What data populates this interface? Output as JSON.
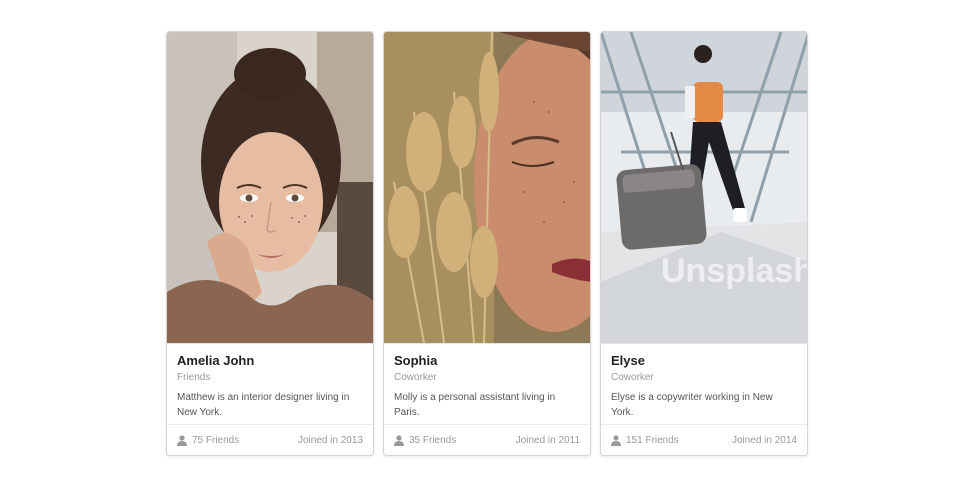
{
  "cards": [
    {
      "name": "Amelia John",
      "meta": "Friends",
      "description": "Matthew is an interior designer living in New York.",
      "friends": "75 Friends",
      "joined": "Joined in 2013"
    },
    {
      "name": "Sophia",
      "meta": "Coworker",
      "description": "Molly is a personal assistant living in Paris.",
      "friends": "35 Friends",
      "joined": "Joined in 2011"
    },
    {
      "name": "Elyse",
      "meta": "Coworker",
      "description": "Elyse is a copywriter working in New York.",
      "friends": "151 Friends",
      "joined": "Joined in 2014"
    }
  ],
  "watermark": "Unsplash"
}
